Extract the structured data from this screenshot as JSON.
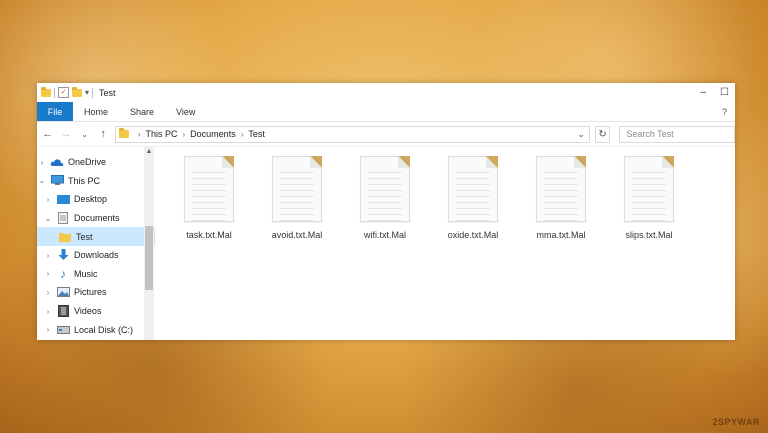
{
  "window": {
    "title": "Test",
    "controls": {
      "minimize": "–",
      "maximize": "☐"
    }
  },
  "ribbon": {
    "tabs": [
      "File",
      "Home",
      "Share",
      "View"
    ],
    "help": "?"
  },
  "address": {
    "crumbs": [
      "This PC",
      "Documents",
      "Test"
    ],
    "search_placeholder": "Search Test"
  },
  "sidebar": {
    "items": [
      {
        "label": "OneDrive",
        "icon": "onedrive-icon"
      },
      {
        "label": "This PC",
        "icon": "computer-icon"
      },
      {
        "label": "Desktop",
        "icon": "desktop-icon"
      },
      {
        "label": "Documents",
        "icon": "documents-icon"
      },
      {
        "label": "Test",
        "icon": "folder-icon"
      },
      {
        "label": "Downloads",
        "icon": "downloads-icon"
      },
      {
        "label": "Music",
        "icon": "music-icon"
      },
      {
        "label": "Pictures",
        "icon": "pictures-icon"
      },
      {
        "label": "Videos",
        "icon": "videos-icon"
      },
      {
        "label": "Local Disk (C:)",
        "icon": "disk-icon"
      }
    ]
  },
  "files": [
    {
      "name": "task.txt.Mal"
    },
    {
      "name": "avoid.txt.Mal"
    },
    {
      "name": "wifi.txt.Mal"
    },
    {
      "name": "oxide.txt.Mal"
    },
    {
      "name": "mma.txt.Mal"
    },
    {
      "name": "slips.txt.Mal"
    }
  ],
  "watermark": "2SPYWAR"
}
